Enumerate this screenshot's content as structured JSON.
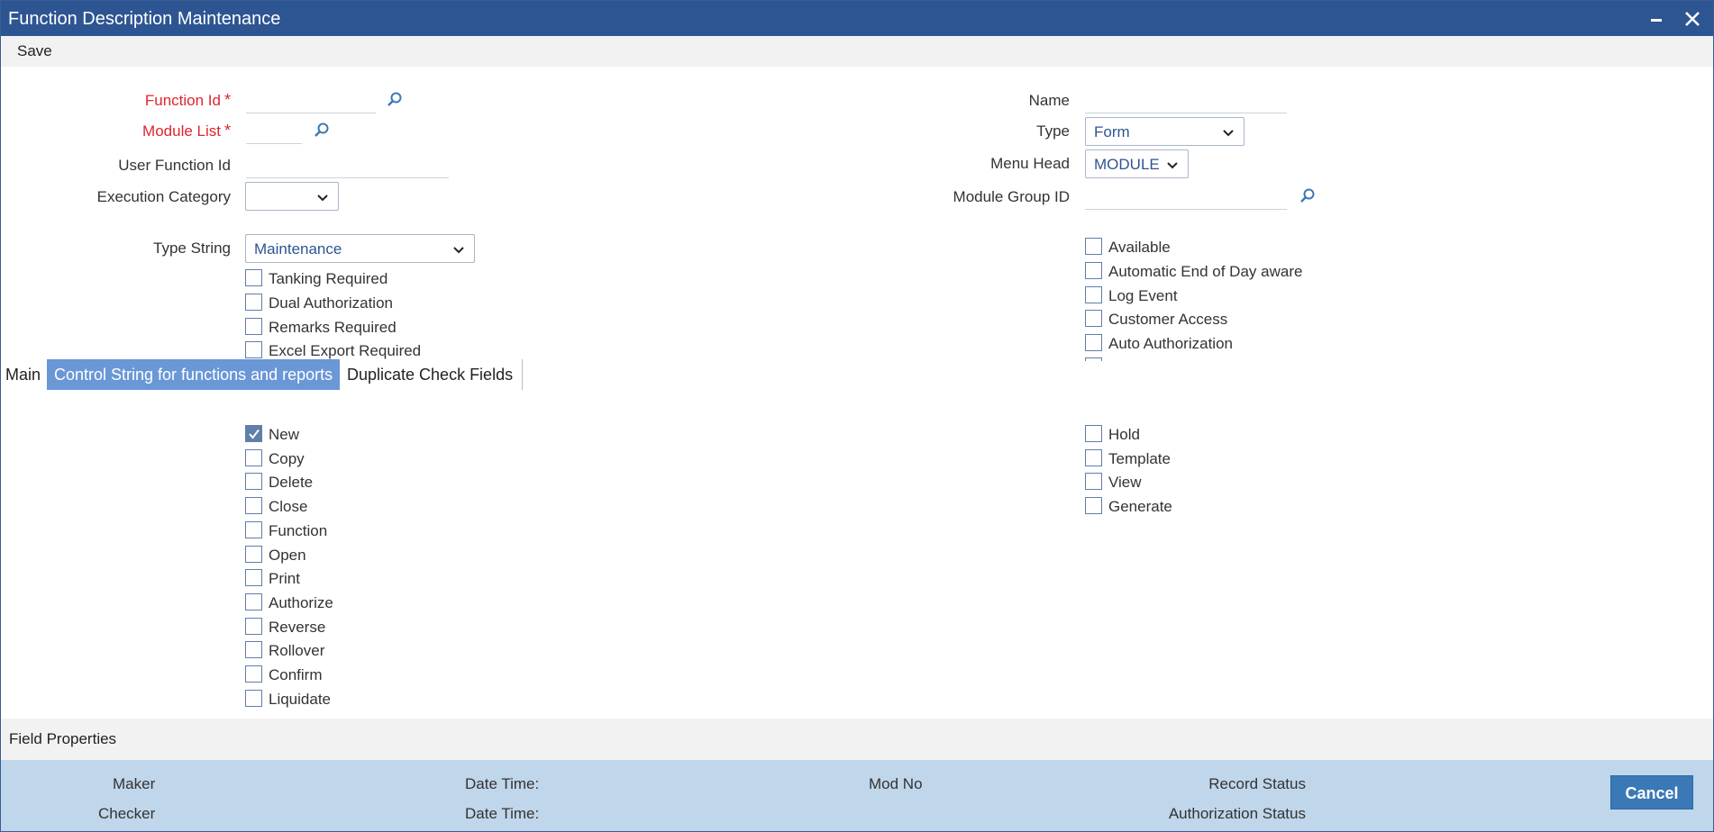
{
  "window": {
    "title": "Function Description Maintenance",
    "minimize_icon": "minimize-icon",
    "close_icon": "close-icon"
  },
  "menu": {
    "save": "Save"
  },
  "form": {
    "function_id": "Function Id",
    "module_list": "Module List",
    "required_mark": "*",
    "user_function_id": "User Function Id",
    "execution_category": "Execution Category",
    "execution_category_value": "",
    "type_string": "Type String",
    "type_string_value": "Maintenance",
    "name": "Name",
    "type": "Type",
    "type_value": "Form",
    "menu_head": "Menu Head",
    "menu_head_value": "MODULE",
    "module_group_id": "Module Group ID"
  },
  "left_checks": [
    {
      "label": "Tanking Required",
      "checked": false
    },
    {
      "label": "Dual Authorization",
      "checked": false
    },
    {
      "label": "Remarks Required",
      "checked": false
    },
    {
      "label": "Excel Export Required",
      "checked": false
    }
  ],
  "right_checks": [
    {
      "label": "Available",
      "checked": false
    },
    {
      "label": "Automatic End of Day aware",
      "checked": false
    },
    {
      "label": "Log Event",
      "checked": false
    },
    {
      "label": "Customer Access",
      "checked": false
    },
    {
      "label": "Auto Authorization",
      "checked": false
    }
  ],
  "tabs": [
    {
      "label": "Main",
      "active": false
    },
    {
      "label": "Control String for functions and reports",
      "active": true
    },
    {
      "label": "Duplicate Check Fields",
      "active": false
    }
  ],
  "control_left": [
    {
      "label": "New",
      "checked": true
    },
    {
      "label": "Copy",
      "checked": false
    },
    {
      "label": "Delete",
      "checked": false
    },
    {
      "label": "Close",
      "checked": false
    },
    {
      "label": "Function",
      "checked": false
    },
    {
      "label": "Open",
      "checked": false
    },
    {
      "label": "Print",
      "checked": false
    },
    {
      "label": "Authorize",
      "checked": false
    },
    {
      "label": "Reverse",
      "checked": false
    },
    {
      "label": "Rollover",
      "checked": false
    },
    {
      "label": "Confirm",
      "checked": false
    },
    {
      "label": "Liquidate",
      "checked": false
    }
  ],
  "control_right": [
    {
      "label": "Hold",
      "checked": false
    },
    {
      "label": "Template",
      "checked": false
    },
    {
      "label": "View",
      "checked": false
    },
    {
      "label": "Generate",
      "checked": false
    }
  ],
  "field_properties": "Field Properties",
  "footer": {
    "maker": "Maker",
    "checker": "Checker",
    "date_time_1": "Date Time:",
    "date_time_2": "Date Time:",
    "mod_no": "Mod No",
    "record_status": "Record Status",
    "authorization_status": "Authorization Status",
    "cancel": "Cancel"
  },
  "colors": {
    "titlebar": "#2d5592",
    "required": "#e0242f",
    "active_tab": "#6a97d6",
    "footer": "#c0d6eb",
    "cancel": "#3b78b6"
  }
}
